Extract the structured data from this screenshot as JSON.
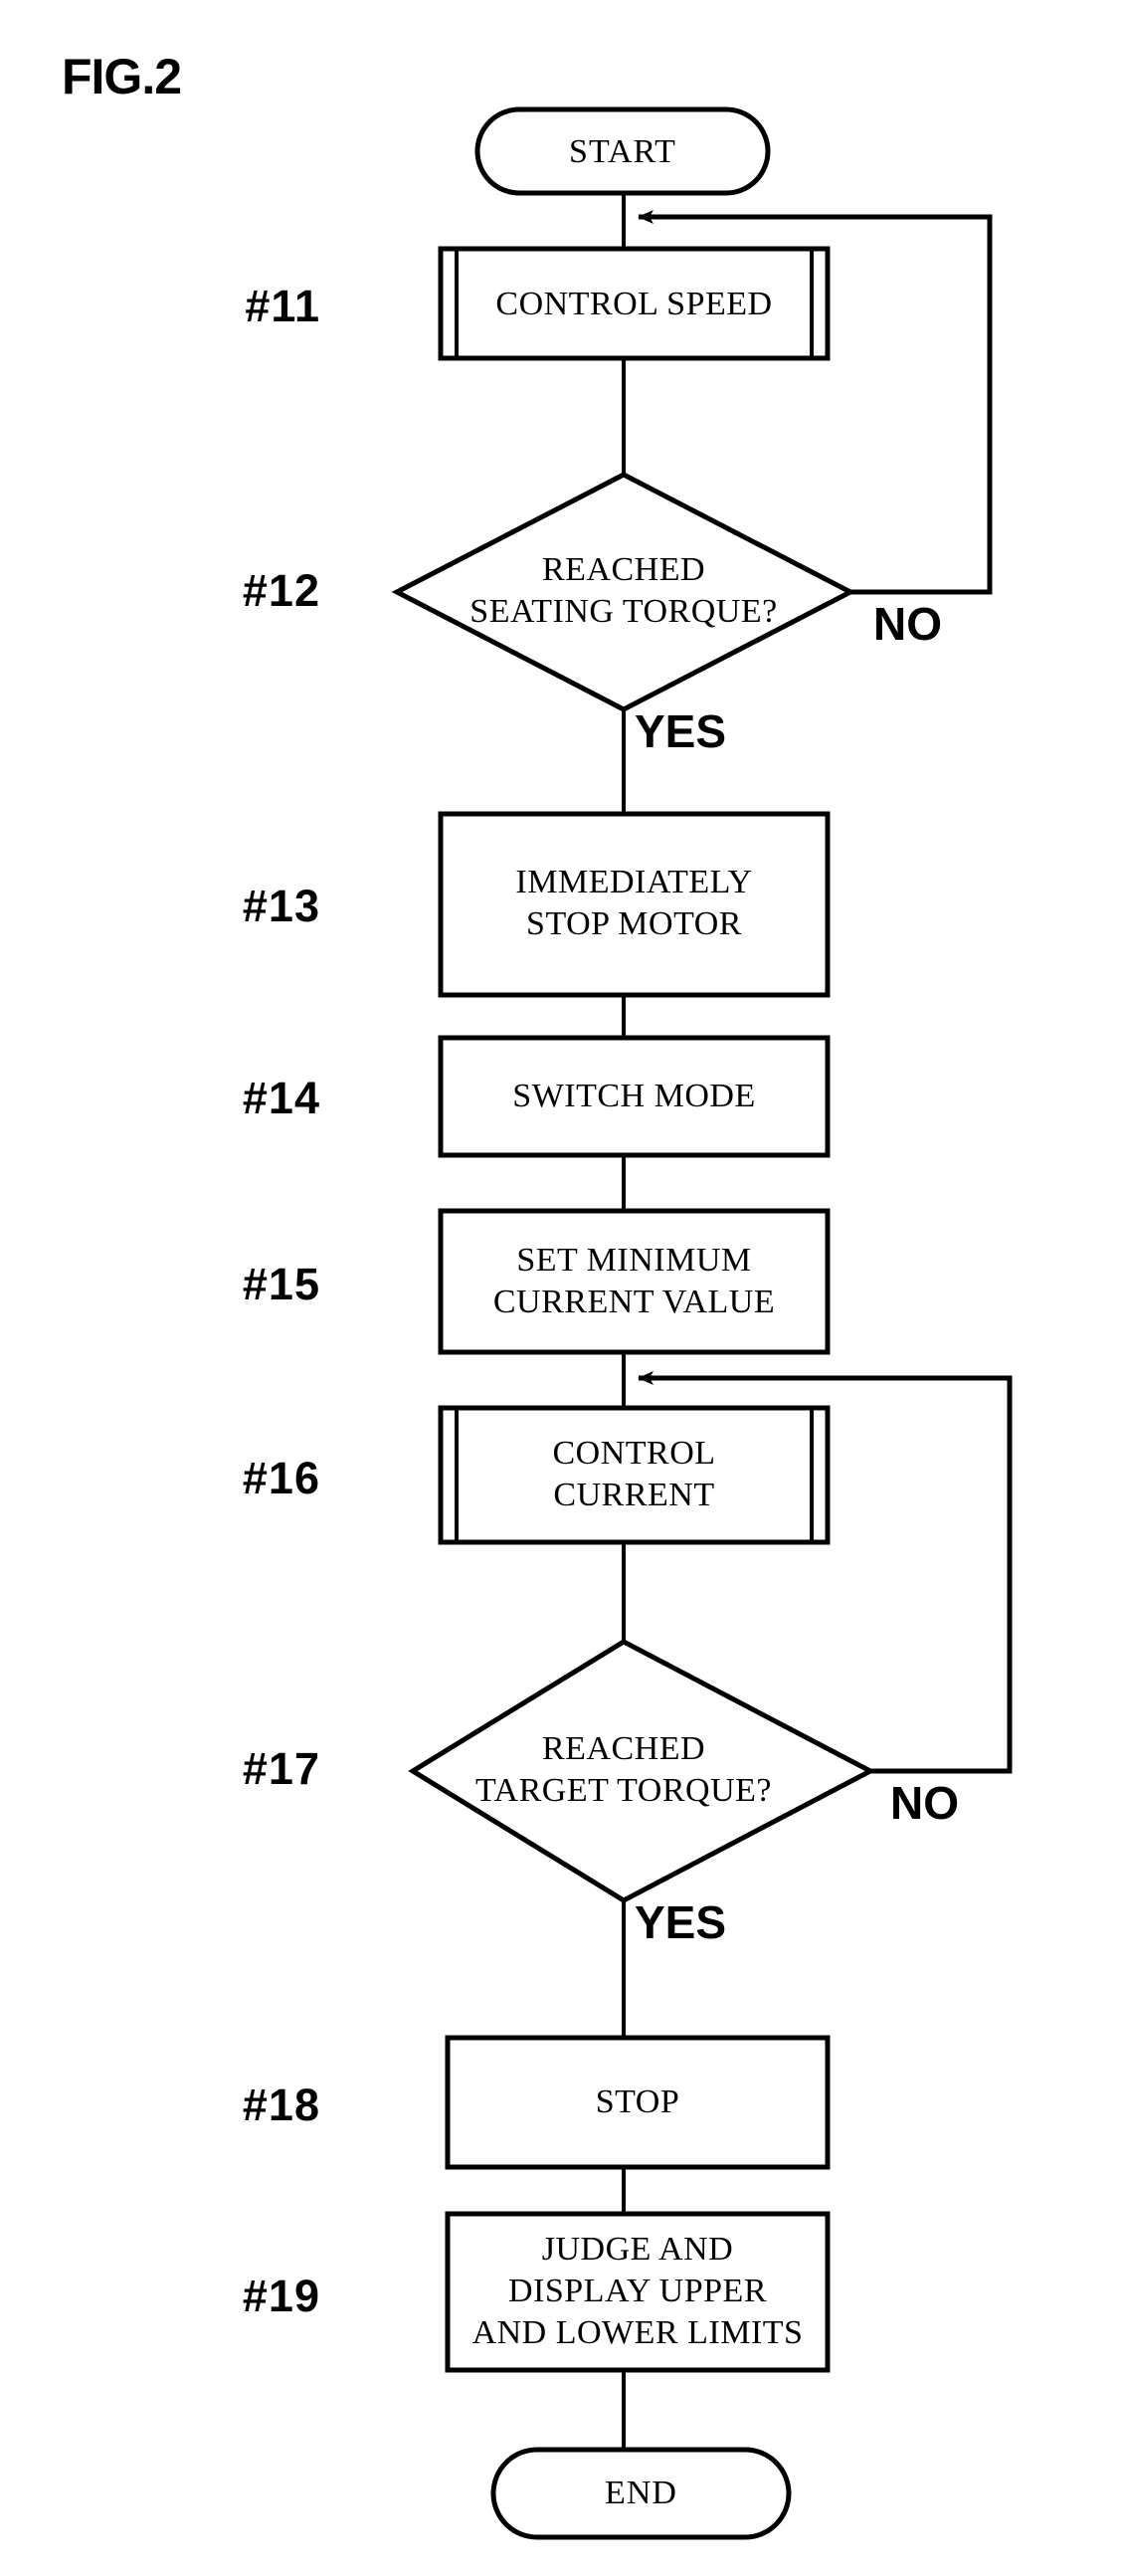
{
  "figure": {
    "label": "FIG.2",
    "type": "flowchart"
  },
  "chart_data": {
    "type": "diagram",
    "title": "FIG.2",
    "nodes": [
      {
        "id": "start",
        "shape": "terminator",
        "text": "START"
      },
      {
        "id": "11",
        "ref": "#11",
        "shape": "predefined-process",
        "text": "CONTROL SPEED"
      },
      {
        "id": "12",
        "ref": "#12",
        "shape": "decision",
        "text": "REACHED\nSEATING TORQUE?"
      },
      {
        "id": "13",
        "ref": "#13",
        "shape": "process",
        "text": "IMMEDIATELY\nSTOP MOTOR"
      },
      {
        "id": "14",
        "ref": "#14",
        "shape": "process",
        "text": "SWITCH MODE"
      },
      {
        "id": "15",
        "ref": "#15",
        "shape": "process",
        "text": "SET MINIMUM\nCURRENT VALUE"
      },
      {
        "id": "16",
        "ref": "#16",
        "shape": "predefined-process",
        "text": "CONTROL\nCURRENT"
      },
      {
        "id": "17",
        "ref": "#17",
        "shape": "decision",
        "text": "REACHED\nTARGET TORQUE?"
      },
      {
        "id": "18",
        "ref": "#18",
        "shape": "process",
        "text": "STOP"
      },
      {
        "id": "19",
        "ref": "#19",
        "shape": "process",
        "text": "JUDGE AND\nDISPLAY UPPER\nAND LOWER LIMITS"
      },
      {
        "id": "end",
        "shape": "terminator",
        "text": "END"
      }
    ],
    "edges": [
      {
        "from": "start",
        "to": "11",
        "label": ""
      },
      {
        "from": "11",
        "to": "12",
        "label": ""
      },
      {
        "from": "12",
        "to": "11",
        "label": "NO"
      },
      {
        "from": "12",
        "to": "13",
        "label": "YES"
      },
      {
        "from": "13",
        "to": "14",
        "label": ""
      },
      {
        "from": "14",
        "to": "15",
        "label": ""
      },
      {
        "from": "15",
        "to": "16",
        "label": ""
      },
      {
        "from": "16",
        "to": "17",
        "label": ""
      },
      {
        "from": "17",
        "to": "16",
        "label": "NO"
      },
      {
        "from": "17",
        "to": "18",
        "label": "YES"
      },
      {
        "from": "18",
        "to": "19",
        "label": ""
      },
      {
        "from": "19",
        "to": "end",
        "label": ""
      }
    ]
  },
  "steps": {
    "s11": {
      "ref": "#11",
      "text": "CONTROL SPEED"
    },
    "s12": {
      "ref": "#12",
      "text": "REACHED\nSEATING TORQUE?"
    },
    "s13": {
      "ref": "#13",
      "text": "IMMEDIATELY\nSTOP MOTOR"
    },
    "s14": {
      "ref": "#14",
      "text": "SWITCH MODE"
    },
    "s15": {
      "ref": "#15",
      "text": "SET MINIMUM\nCURRENT VALUE"
    },
    "s16": {
      "ref": "#16",
      "text": "CONTROL\nCURRENT"
    },
    "s17": {
      "ref": "#17",
      "text": "REACHED\nTARGET TORQUE?"
    },
    "s18": {
      "ref": "#18",
      "text": "STOP"
    },
    "s19": {
      "ref": "#19",
      "text": "JUDGE AND\nDISPLAY UPPER\nAND LOWER LIMITS"
    }
  },
  "terminals": {
    "start": "START",
    "end": "END"
  },
  "branches": {
    "no_1": "NO",
    "yes_1": "YES",
    "no_2": "NO",
    "yes_2": "YES"
  },
  "colors": {
    "ink": "#000000",
    "paper": "#ffffff"
  }
}
